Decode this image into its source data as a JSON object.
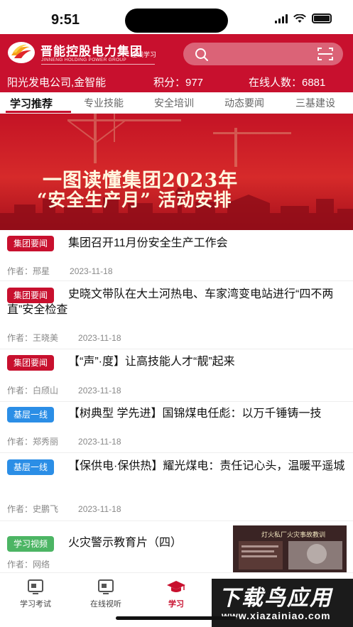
{
  "status": {
    "time": "9:51"
  },
  "header": {
    "brand_name": "晋能控股电力集团",
    "brand_en": "JINNENG HOLDING POWER GROUP",
    "brand_sub": "在线学习"
  },
  "info": {
    "company": "阳光发电公司,金智能",
    "points": "积分：977",
    "online": "在线人数：6881"
  },
  "tabs": [
    "学习推荐",
    "专业技能",
    "安全培训",
    "动态要闻",
    "三基建设"
  ],
  "banner": {
    "title1": "一图读懂集团2023年",
    "title2": "“安全生产月” 活动安排"
  },
  "news": [
    {
      "tag": "集团要闻",
      "title": "集团召开11月份安全生产工作会",
      "author": "作者：邢星",
      "date": "2023-11-18"
    },
    {
      "tag": "集团要闻",
      "title": "史晓文带队在大土河热电、车家湾变电站进行“四不两直”安全检查",
      "author": "作者：王晓美",
      "date": "2023-11-18"
    },
    {
      "tag": "集团要闻",
      "title": "【“声”·度】让高技能人才“靓”起来",
      "author": "作者：白颀山",
      "date": "2023-11-18"
    },
    {
      "tag": "基层一线",
      "title": "【树典型 学先进】国锦煤电任彪：以万千锤铸一技",
      "author": "作者：郑秀丽",
      "date": "2023-11-18"
    },
    {
      "tag": "基层一线",
      "title": "【保供电·保供热】耀光煤电：责任记心头，温暖平遥城",
      "author": "作者：史鹏飞",
      "date": "2023-11-18"
    },
    {
      "tag": "学习视频",
      "title": "火灾警示教育片（四）",
      "author": "作者：网络",
      "date": ""
    }
  ],
  "video_thumb": {
    "caption": "灯火私厂火灾事故教训"
  },
  "bottom_nav": [
    "学习考试",
    "在线视听",
    "学习"
  ],
  "watermark": {
    "line1": "下载鸟应用",
    "line2": "www.xiazainiao.com"
  },
  "colors": {
    "brand_red": "#c8102e",
    "tag_blue": "#2b8ee6",
    "tag_green": "#4cb564"
  }
}
